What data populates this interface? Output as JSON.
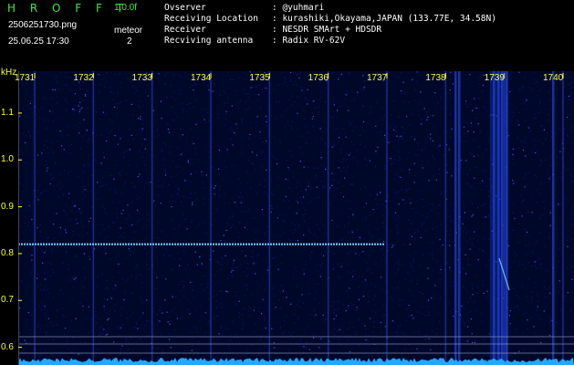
{
  "header": {
    "brand": "H R O F F T",
    "version": "1.0.0f",
    "filename": "2506251730.png",
    "datetime": "25.06.25 17:30",
    "meteor_label": "meteor",
    "meteor_count": "2"
  },
  "info": [
    {
      "key": "Ovserver",
      "value": ": @yuhmari"
    },
    {
      "key": "Receiving Location",
      "value": ": kurashiki,Okayama,JAPAN (133.77E, 34.58N)"
    },
    {
      "key": "Receiver",
      "value": ": NESDR SMArt + HDSDR"
    },
    {
      "key": "Recviving antenna",
      "value": ": Radix RV-62V"
    }
  ],
  "chart_data": {
    "type": "heatmap",
    "ylabel": "kHz",
    "x_ticks": [
      "1731",
      "1732",
      "1733",
      "1734",
      "1735",
      "1736",
      "1737",
      "1738",
      "1739",
      "1740"
    ],
    "y_ticks": [
      "1.1",
      "1.0",
      "0.9",
      "0.8",
      "0.7",
      "0.6"
    ],
    "ylim": [
      0.57,
      1.17
    ],
    "meteor_trace_khz": 0.82,
    "colors": {
      "background": "#00082a",
      "noise": "#0a1a7a",
      "signal": "#7ad0ff",
      "baseline": "#22a8ff"
    }
  }
}
